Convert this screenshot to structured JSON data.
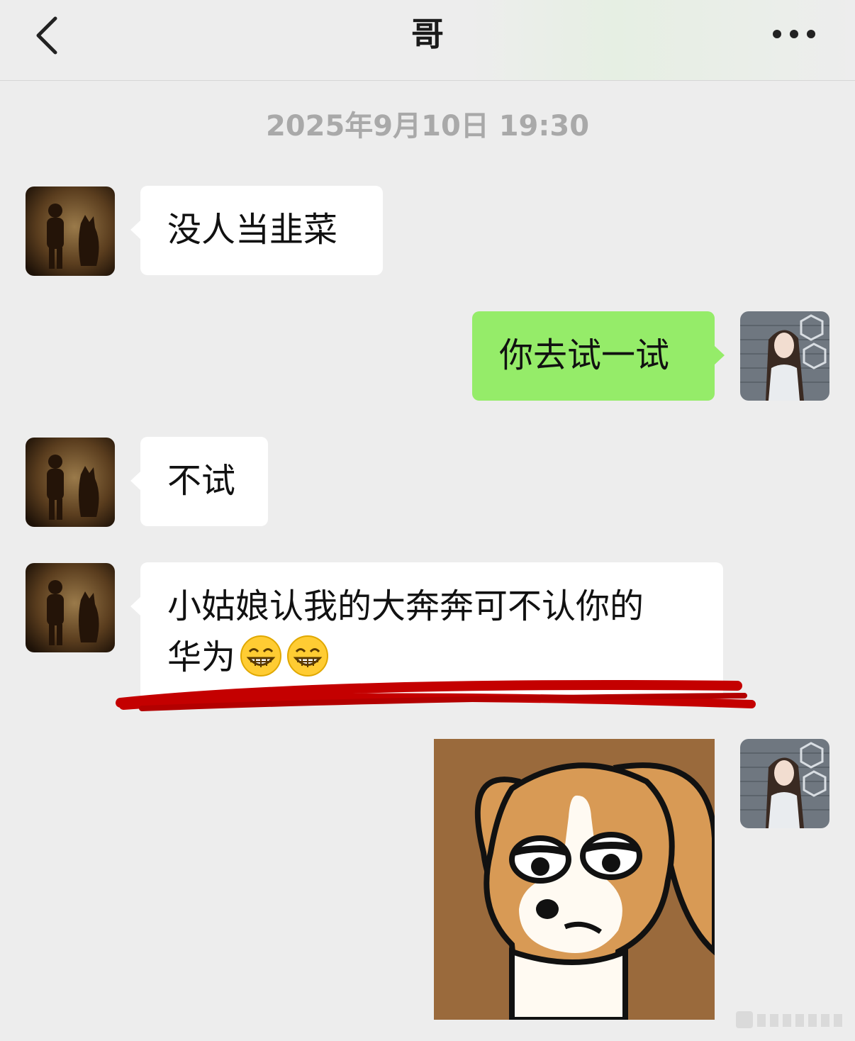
{
  "header": {
    "title": "哥",
    "back_icon": "chevron-left-icon",
    "more_icon": "more-dots-icon"
  },
  "timestamp": "2025年9月10日 19:30",
  "messages": [
    {
      "direction": "incoming",
      "text": "没人当韭菜"
    },
    {
      "direction": "outgoing",
      "text": "你去试一试"
    },
    {
      "direction": "incoming",
      "text": "不试"
    },
    {
      "direction": "incoming",
      "text_line1": "小姑娘认我的大奔奔可不认你的",
      "text_line2": "华为",
      "emojis": [
        "grinning-teeth-emoji",
        "grinning-teeth-emoji"
      ]
    },
    {
      "direction": "outgoing",
      "type": "sticker",
      "sticker": "cartoon-dog-sticker"
    }
  ],
  "colors": {
    "background": "#ededed",
    "incoming_bubble": "#ffffff",
    "outgoing_bubble": "#95ec69",
    "annotation_red": "#c40000"
  }
}
